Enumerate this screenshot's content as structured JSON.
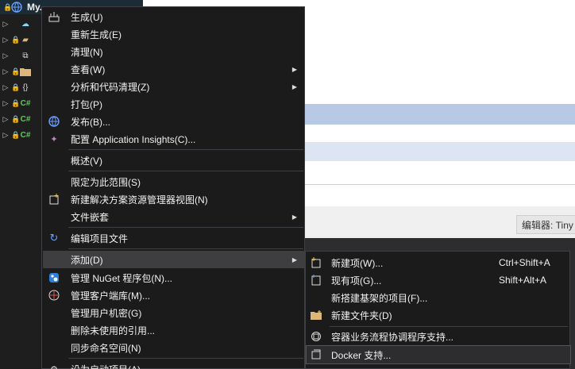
{
  "tree": {
    "title": "My...",
    "cs_label": "C#"
  },
  "editor_tag": "编辑器: Tiny",
  "menu": {
    "items": [
      {
        "label": "生成(U)",
        "icon": "build-icon"
      },
      {
        "label": "重新生成(E)"
      },
      {
        "label": "清理(N)"
      },
      {
        "label": "查看(W)",
        "submenu": true
      },
      {
        "label": "分析和代码清理(Z)",
        "submenu": true
      },
      {
        "label": "打包(P)"
      },
      {
        "label": "发布(B)...",
        "icon": "globe-icon"
      },
      {
        "label": "配置 Application Insights(C)...",
        "icon": "bulb-icon"
      },
      {
        "label": "概述(V)"
      },
      {
        "label": "限定为此范围(S)"
      },
      {
        "label": "新建解决方案资源管理器视图(N)",
        "icon": "new-view-icon"
      },
      {
        "label": "文件嵌套",
        "submenu": true
      },
      {
        "label": "编辑项目文件",
        "icon": "edit-icon"
      },
      {
        "label": "添加(D)",
        "submenu": true,
        "active": true
      },
      {
        "label": "管理 NuGet 程序包(N)...",
        "icon": "nuget-icon"
      },
      {
        "label": "管理客户端库(M)...",
        "icon": "library-icon"
      },
      {
        "label": "管理用户机密(G)"
      },
      {
        "label": "删除未使用的引用..."
      },
      {
        "label": "同步命名空间(N)"
      },
      {
        "label": "设为启动项目(A)",
        "icon": "gear-icon"
      }
    ]
  },
  "submenu": {
    "items": [
      {
        "label": "新建项(W)...",
        "shortcut": "Ctrl+Shift+A",
        "icon": "new-item-icon"
      },
      {
        "label": "现有项(G)...",
        "shortcut": "Shift+Alt+A",
        "icon": "existing-item-icon"
      },
      {
        "label": "新搭建基架的项目(F)...",
        "shortcut": ""
      },
      {
        "label": "新建文件夹(D)",
        "shortcut": "",
        "icon": "folder-icon"
      },
      {
        "label": "容器业务流程协调程序支持...",
        "shortcut": "",
        "icon": "container-icon"
      },
      {
        "label": "Docker 支持...",
        "shortcut": "",
        "icon": "docker-icon",
        "hover": true
      }
    ]
  }
}
